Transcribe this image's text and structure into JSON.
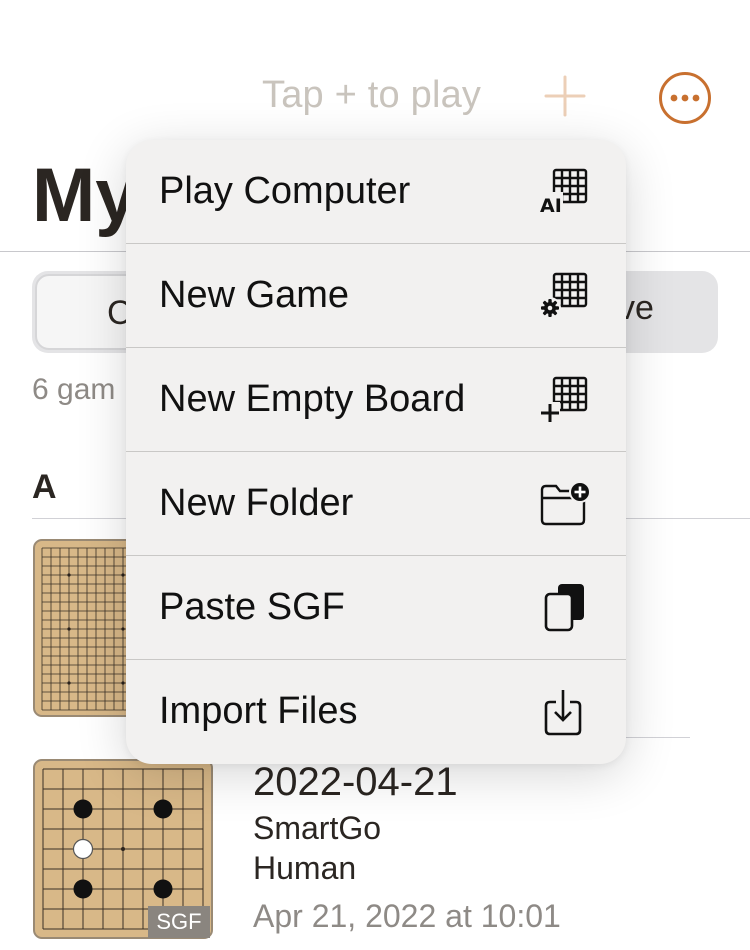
{
  "topbar": {
    "hint": "Tap + to play",
    "plus_icon": "plus-icon",
    "more_icon": "ellipsis-circle-icon",
    "accent_color": "#c8702f"
  },
  "page": {
    "title": "My",
    "segment_left": "C",
    "segment_right": "ve",
    "games_count": "6 gam",
    "section_header": "A"
  },
  "games": [
    {
      "thumbnail": "go-board-19x19-empty",
      "badge": ""
    },
    {
      "thumbnail": "go-board-9x9",
      "badge": "SGF",
      "title": "2022-04-21",
      "black": "SmartGo",
      "white": "Human",
      "date": "Apr 21, 2022 at 10:01"
    }
  ],
  "menu": {
    "items": [
      {
        "label": "Play Computer",
        "icon": "board-ai-icon"
      },
      {
        "label": "New Game",
        "icon": "board-gear-icon"
      },
      {
        "label": "New Empty Board",
        "icon": "board-plus-icon"
      },
      {
        "label": "New Folder",
        "icon": "folder-plus-icon"
      },
      {
        "label": "Paste SGF",
        "icon": "paste-icon"
      },
      {
        "label": "Import Files",
        "icon": "import-icon"
      }
    ]
  }
}
